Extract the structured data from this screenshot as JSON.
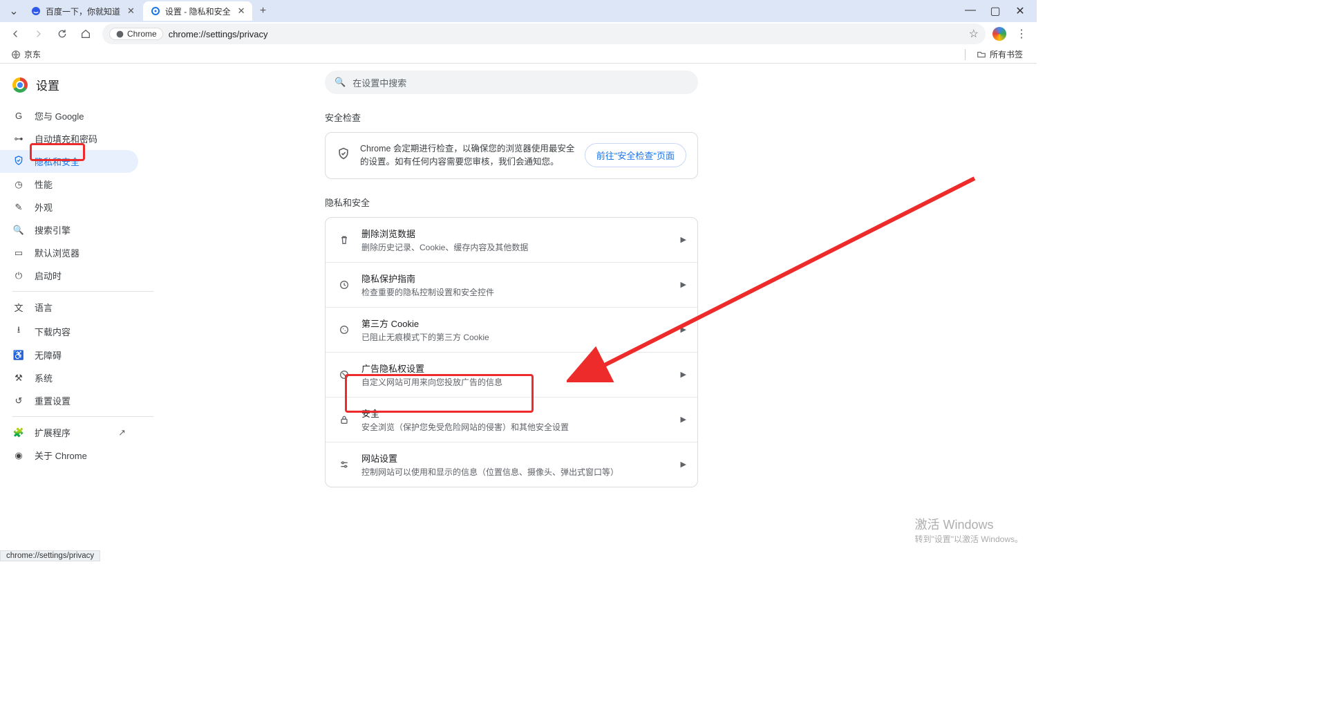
{
  "tabs": [
    {
      "title": "百度一下，你就知道"
    },
    {
      "title": "设置 - 隐私和安全"
    }
  ],
  "omnibox": {
    "chip": "Chrome",
    "url": "chrome://settings/privacy"
  },
  "bookmarks": {
    "jd": "京东",
    "allbm": "所有书签"
  },
  "brand": "设置",
  "sidebar": {
    "items": [
      {
        "label": "您与 Google"
      },
      {
        "label": "自动填充和密码"
      },
      {
        "label": "隐私和安全"
      },
      {
        "label": "性能"
      },
      {
        "label": "外观"
      },
      {
        "label": "搜索引擎"
      },
      {
        "label": "默认浏览器"
      },
      {
        "label": "启动时"
      }
    ],
    "items2": [
      {
        "label": "语言"
      },
      {
        "label": "下载内容"
      },
      {
        "label": "无障碍"
      },
      {
        "label": "系统"
      },
      {
        "label": "重置设置"
      }
    ],
    "items3": [
      {
        "label": "扩展程序"
      },
      {
        "label": "关于 Chrome"
      }
    ]
  },
  "search": {
    "placeholder": "在设置中搜索"
  },
  "sec_check": {
    "title": "安全检查",
    "body": "Chrome 会定期进行检查，以确保您的浏览器使用最安全的设置。如有任何内容需要您审核，我们会通知您。",
    "btn": "前往\"安全检查\"页面"
  },
  "privacy": {
    "title": "隐私和安全",
    "rows": [
      {
        "title": "删除浏览数据",
        "sub": "删除历史记录、Cookie、缓存内容及其他数据"
      },
      {
        "title": "隐私保护指南",
        "sub": "检查重要的隐私控制设置和安全控件"
      },
      {
        "title": "第三方 Cookie",
        "sub": "已阻止无痕模式下的第三方 Cookie"
      },
      {
        "title": "广告隐私权设置",
        "sub": "自定义网站可用来向您投放广告的信息"
      },
      {
        "title": "安全",
        "sub": "安全浏览（保护您免受危险网站的侵害）和其他安全设置"
      },
      {
        "title": "网站设置",
        "sub": "控制网站可以使用和显示的信息（位置信息、摄像头、弹出式窗口等）"
      }
    ]
  },
  "watermark": {
    "l1": "激活 Windows",
    "l2": "转到\"设置\"以激活 Windows。"
  },
  "status": "chrome://settings/privacy"
}
